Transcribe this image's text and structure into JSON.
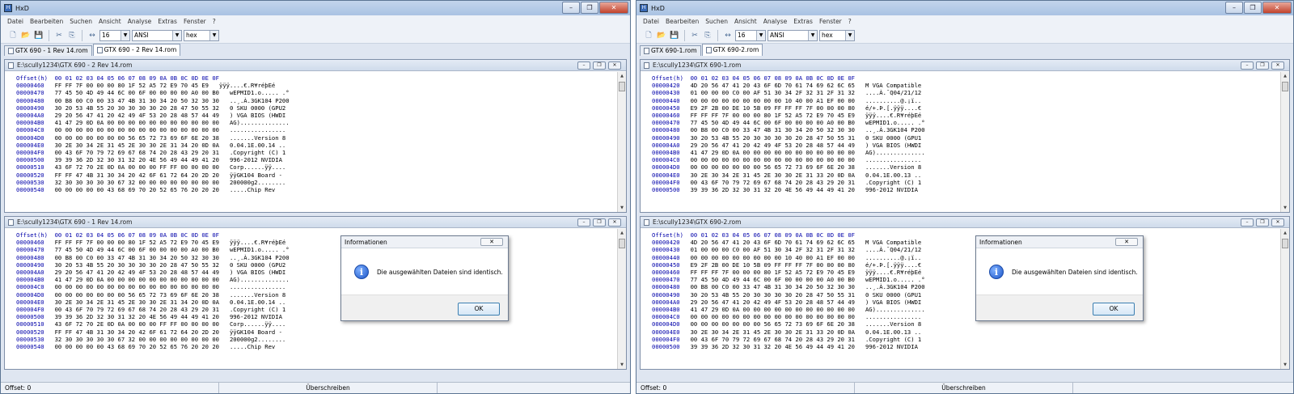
{
  "menu": [
    "Datei",
    "Bearbeiten",
    "Suchen",
    "Ansicht",
    "Analyse",
    "Extras",
    "Fenster",
    "?"
  ],
  "toolbar": {
    "bytes_per_row": "16",
    "charset": "ANSI",
    "offset_base": "hex"
  },
  "hex_header": "Offset(h)  00 01 02 03 04 05 06 07 08 09 0A 0B 0C 0D 0E 0F",
  "status": {
    "offset": "Offset: 0",
    "mode": "Überschreiben"
  },
  "dialog": {
    "title": "Informationen",
    "message": "Die ausgewählten Dateien sind identisch.",
    "ok": "OK",
    "close_glyph": "✕"
  },
  "left": {
    "title": "HxD",
    "tabs": [
      "GTX 690 - 1 Rev 14.rom",
      "GTX 690 - 2 Rev 14.rom"
    ],
    "active_tab": 1,
    "top_path": "E:\\scully1234\\GTX 690 - 2 Rev 14.rom",
    "bottom_path": "E:\\scully1234\\GTX 690 - 1 Rev 14.rom",
    "top_rows": [
      {
        "off": "00000460",
        "hex": "FF FF 7F 00 00 00 80 1F 52 A5 72 E9 70 45 E9",
        "txt": "ÿÿÿ....€.R¥réþEé"
      },
      {
        "off": "00000470",
        "hex": "77 45 50 4D 49 44 6C 00 6F 00 00 00 00 A0 00 B0",
        "txt": "wEPMID1.o..... .°"
      },
      {
        "off": "00000480",
        "hex": "00 B8 00 C0 00 33 47 4B 31 30 34 20 50 32 30 30",
        "txt": "..¸.À.3GK104 P200"
      },
      {
        "off": "00000490",
        "hex": "30 20 53 4B 55 20 30 30 30 30 20 28 47 50 55 32",
        "txt": "0 SKU 0000 (GPU2"
      },
      {
        "off": "000004A0",
        "hex": "29 20 56 47 41 20 42 49 4F 53 20 28 48 57 44 49",
        "txt": ") VGA BIOS (HWDI"
      },
      {
        "off": "000004B0",
        "hex": "41 47 29 0D 0A 00 00 00 00 00 00 00 00 00 00 00",
        "txt": "AG).............."
      },
      {
        "off": "000004C0",
        "hex": "00 00 00 00 00 00 00 00 00 00 00 00 00 00 00 00",
        "txt": "................"
      },
      {
        "off": "000004D0",
        "hex": "00 00 00 00 00 00 00 56 65 72 73 69 6F 6E 20 38",
        "txt": ".......Version 8"
      },
      {
        "off": "000004E0",
        "hex": "30 2E 30 34 2E 31 45 2E 30 30 2E 31 34 20 0D 0A",
        "txt": "0.04.1E.00.14 .."
      },
      {
        "off": "000004F0",
        "hex": "00 43 6F 70 79 72 69 67 68 74 20 28 43 29 20 31",
        "txt": ".Copyright (C) 1"
      },
      {
        "off": "00000500",
        "hex": "39 39 36 2D 32 30 31 32 20 4E 56 49 44 49 41 20",
        "txt": "996-2012 NVIDIA"
      },
      {
        "off": "00000510",
        "hex": "43 6F 72 70 2E 0D 0A 00 00 00 FF FF 00 00 00 00",
        "txt": "Corp......ÿÿ...."
      },
      {
        "off": "00000520",
        "hex": "FF FF 47 4B 31 30 34 20 42 6F 61 72 64 20 2D 20",
        "txt": "ÿÿGK104 Board -"
      },
      {
        "off": "00000530",
        "hex": "32 30 30 30 30 30 67 32 00 00 00 00 00 00 00 00",
        "txt": "200000g2........"
      },
      {
        "off": "00000540",
        "hex": "00 00 00 00 00 43 68 69 70 20 52 65 76 20 20 20",
        "txt": ".....Chip Rev"
      }
    ],
    "bottom_rows": [
      {
        "off": "00000460",
        "hex": "FF FF FF 7F 00 00 00 80 1F 52 A5 72 E9 70 45 E9",
        "txt": "ÿÿÿ....€.R¥réþEé"
      },
      {
        "off": "00000470",
        "hex": "77 45 50 4D 49 44 6C 00 6F 00 00 00 00 A0 00 B0",
        "txt": "wEPMID1.o..... .°"
      },
      {
        "off": "00000480",
        "hex": "00 B8 00 C0 00 33 47 4B 31 30 34 20 50 32 30 30",
        "txt": "..¸.À.3GK104 P200"
      },
      {
        "off": "00000490",
        "hex": "30 20 53 4B 55 20 30 30 30 30 20 28 47 50 55 32",
        "txt": "0 SKU 0000 (GPU2"
      },
      {
        "off": "000004A0",
        "hex": "29 20 56 47 41 20 42 49 4F 53 20 28 48 57 44 49",
        "txt": ") VGA BIOS (HWDI"
      },
      {
        "off": "000004B0",
        "hex": "41 47 29 0D 0A 00 00 00 00 00 00 00 00 00 00 00",
        "txt": "AG).............."
      },
      {
        "off": "000004C0",
        "hex": "00 00 00 00 00 00 00 00 00 00 00 00 00 00 00 00",
        "txt": "................"
      },
      {
        "off": "000004D0",
        "hex": "00 00 00 00 00 00 00 56 65 72 73 69 6F 6E 20 38",
        "txt": ".......Version 8"
      },
      {
        "off": "000004E0",
        "hex": "30 2E 30 34 2E 31 45 2E 30 30 2E 31 34 20 0D 0A",
        "txt": "0.04.1E.00.14 .."
      },
      {
        "off": "000004F0",
        "hex": "00 43 6F 70 79 72 69 67 68 74 20 28 43 29 20 31",
        "txt": ".Copyright (C) 1"
      },
      {
        "off": "00000500",
        "hex": "39 39 36 2D 32 30 31 32 20 4E 56 49 44 49 41 20",
        "txt": "996-2012 NVIDIA"
      },
      {
        "off": "00000510",
        "hex": "43 6F 72 70 2E 0D 0A 00 00 00 FF FF 00 00 00 00",
        "txt": "Corp......ÿÿ...."
      },
      {
        "off": "00000520",
        "hex": "FF FF 47 4B 31 30 34 20 42 6F 61 72 64 20 2D 20",
        "txt": "ÿÿGK104 Board -"
      },
      {
        "off": "00000530",
        "hex": "32 30 30 30 30 30 67 32 00 00 00 00 00 00 00 00",
        "txt": "200000g2........"
      },
      {
        "off": "00000540",
        "hex": "00 00 00 00 00 43 68 69 70 20 52 65 76 20 20 20",
        "txt": ".....Chip Rev"
      }
    ]
  },
  "right": {
    "title": "HxD",
    "tabs": [
      "GTX 690-1.rom",
      "GTX 690-2.rom"
    ],
    "active_tab": 1,
    "top_path": "E:\\scully1234\\GTX 690-1.rom",
    "bottom_path": "E:\\scully1234\\GTX 690-2.rom",
    "top_rows": [
      {
        "off": "00000420",
        "hex": "4D 20 56 47 41 20 43 6F 6D 70 61 74 69 62 6C 65",
        "txt": "M VGA Compatible"
      },
      {
        "off": "00000430",
        "hex": "01 00 00 00 C0 00 AF 51 30 34 2F 32 31 2F 31 32",
        "txt": "....À.¯Q04/21/12"
      },
      {
        "off": "00000440",
        "hex": "00 00 00 00 00 00 00 00 00 10 40 00 A1 EF 00 00",
        "txt": "..........@.¡ï.."
      },
      {
        "off": "00000450",
        "hex": "E9 2F 2B 00 DE 10 5B 09 FF FF FF 7F 00 00 00 80",
        "txt": "é/+.Þ.[.ÿÿÿ....€"
      },
      {
        "off": "00000460",
        "hex": "FF FF FF 7F 00 00 00 80 1F 52 A5 72 E9 70 45 E9",
        "txt": "ÿÿÿ....€.R¥réþEé"
      },
      {
        "off": "00000470",
        "hex": "77 45 50 4D 49 44 6C 00 6F 00 00 00 00 A0 00 B0",
        "txt": "wEPMID1.o..... .°"
      },
      {
        "off": "00000480",
        "hex": "00 B8 00 C0 00 33 47 4B 31 30 34 20 50 32 30 30",
        "txt": "..¸.À.3GK104 P200"
      },
      {
        "off": "00000490",
        "hex": "30 20 53 4B 55 20 30 30 30 30 20 28 47 50 55 31",
        "txt": "0 SKU 0000 (GPU1"
      },
      {
        "off": "000004A0",
        "hex": "29 20 56 47 41 20 42 49 4F 53 20 28 48 57 44 49",
        "txt": ") VGA BIOS (HWDI"
      },
      {
        "off": "000004B0",
        "hex": "41 47 29 0D 0A 00 00 00 00 00 00 00 00 00 00 00",
        "txt": "AG).............."
      },
      {
        "off": "000004C0",
        "hex": "00 00 00 00 00 00 00 00 00 00 00 00 00 00 00 00",
        "txt": "................"
      },
      {
        "off": "000004D0",
        "hex": "00 00 00 00 00 00 00 56 65 72 73 69 6F 6E 20 38",
        "txt": ".......Version 8"
      },
      {
        "off": "000004E0",
        "hex": "30 2E 30 34 2E 31 45 2E 30 30 2E 31 33 20 0D 0A",
        "txt": "0.04.1E.00.13 .."
      },
      {
        "off": "000004F0",
        "hex": "00 43 6F 70 79 72 69 67 68 74 20 28 43 29 20 31",
        "txt": ".Copyright (C) 1"
      },
      {
        "off": "00000500",
        "hex": "39 39 36 2D 32 30 31 32 20 4E 56 49 44 49 41 20",
        "txt": "996-2012 NVIDIA"
      }
    ],
    "bottom_rows": [
      {
        "off": "00000420",
        "hex": "4D 20 56 47 41 20 43 6F 6D 70 61 74 69 62 6C 65",
        "txt": "M VGA Compatible"
      },
      {
        "off": "00000430",
        "hex": "01 00 00 00 C0 00 AF 51 30 34 2F 32 31 2F 31 32",
        "txt": "....À.¯Q04/21/12"
      },
      {
        "off": "00000440",
        "hex": "00 00 00 00 00 00 00 00 00 10 40 00 A1 EF 00 00",
        "txt": "..........@.¡ï.."
      },
      {
        "off": "00000450",
        "hex": "E9 2F 2B 00 DE 10 5B 09 FF FF FF 7F 00 00 00 80",
        "txt": "é/+.Þ.[.ÿÿÿ....€"
      },
      {
        "off": "00000460",
        "hex": "FF FF FF 7F 00 00 00 80 1F 52 A5 72 E9 70 45 E9",
        "txt": "ÿÿÿ....€.R¥réþEé"
      },
      {
        "off": "00000470",
        "hex": "77 45 50 4D 49 44 6C 00 6F 00 00 00 00 A0 00 B0",
        "txt": "wEPMID1.o..... .°"
      },
      {
        "off": "00000480",
        "hex": "00 B8 00 C0 00 33 47 4B 31 30 34 20 50 32 30 30",
        "txt": "..¸.À.3GK104 P200"
      },
      {
        "off": "00000490",
        "hex": "30 20 53 4B 55 20 30 30 30 30 20 28 47 50 55 31",
        "txt": "0 SKU 0000 (GPU1"
      },
      {
        "off": "000004A0",
        "hex": "29 20 56 47 41 20 42 49 4F 53 20 28 48 57 44 49",
        "txt": ") VGA BIOS (HWDI"
      },
      {
        "off": "000004B0",
        "hex": "41 47 29 0D 0A 00 00 00 00 00 00 00 00 00 00 00",
        "txt": "AG).............."
      },
      {
        "off": "000004C0",
        "hex": "00 00 00 00 00 00 00 00 00 00 00 00 00 00 00 00",
        "txt": "................"
      },
      {
        "off": "000004D0",
        "hex": "00 00 00 00 00 00 00 56 65 72 73 69 6F 6E 20 38",
        "txt": ".......Version 8"
      },
      {
        "off": "000004E0",
        "hex": "30 2E 30 34 2E 31 45 2E 30 30 2E 31 33 20 0D 0A",
        "txt": "0.04.1E.00.13 .."
      },
      {
        "off": "000004F0",
        "hex": "00 43 6F 70 79 72 69 67 68 74 20 28 43 29 20 31",
        "txt": ".Copyright (C) 1"
      },
      {
        "off": "00000500",
        "hex": "39 39 36 2D 32 30 31 32 20 4E 56 49 44 49 41 20",
        "txt": "996-2012 NVIDIA"
      }
    ]
  }
}
